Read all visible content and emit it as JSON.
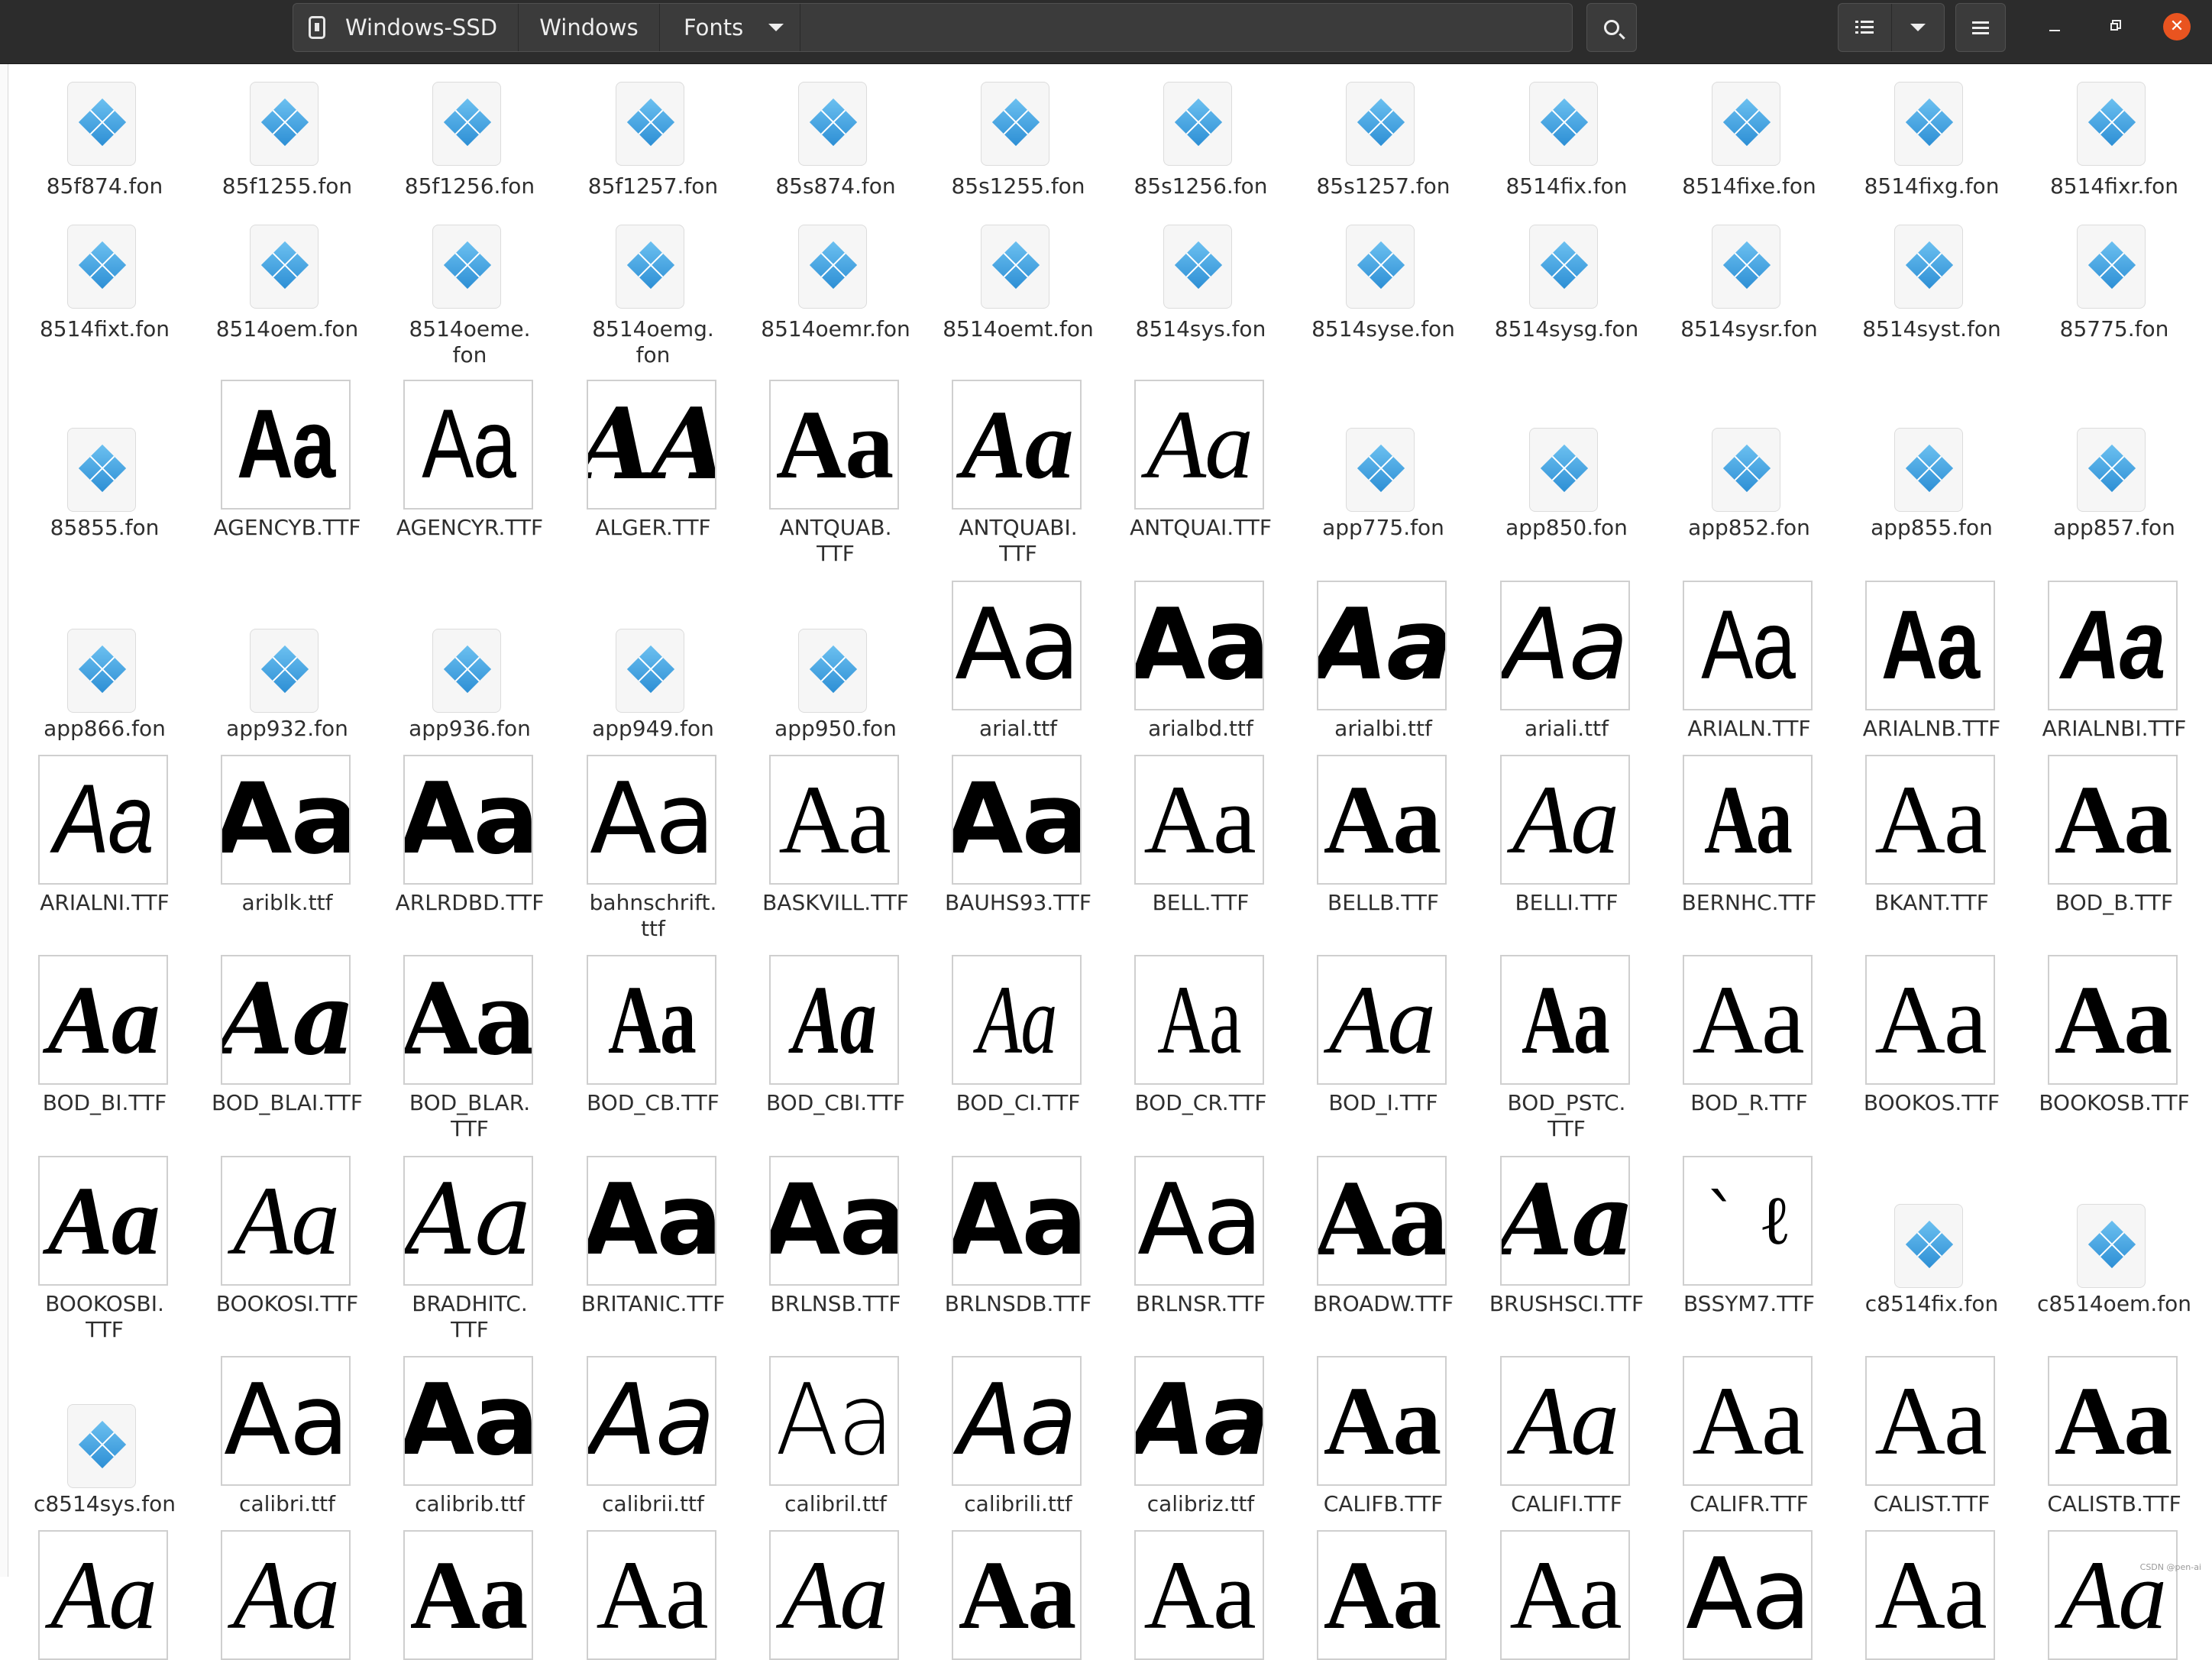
{
  "header": {
    "breadcrumb": [
      "Windows-SSD",
      "Windows",
      "Fonts"
    ],
    "icons": {
      "drive": "drive-icon",
      "search": "search-icon",
      "list_view": "list-view-icon",
      "view_options": "chevron-down-icon",
      "menu": "hamburger-menu-icon",
      "minimize": "minimize-icon",
      "maximize": "maximize-icon",
      "close": "close-icon"
    },
    "close_color": "#e95420"
  },
  "files": [
    {
      "name": "85f874.fon",
      "kind": "fon"
    },
    {
      "name": "85f1255.fon",
      "kind": "fon"
    },
    {
      "name": "85f1256.fon",
      "kind": "fon"
    },
    {
      "name": "85f1257.fon",
      "kind": "fon"
    },
    {
      "name": "85s874.fon",
      "kind": "fon"
    },
    {
      "name": "85s1255.fon",
      "kind": "fon"
    },
    {
      "name": "85s1256.fon",
      "kind": "fon"
    },
    {
      "name": "85s1257.fon",
      "kind": "fon"
    },
    {
      "name": "8514fix.fon",
      "kind": "fon"
    },
    {
      "name": "8514fixe.fon",
      "kind": "fon"
    },
    {
      "name": "8514fixg.fon",
      "kind": "fon"
    },
    {
      "name": "8514fixr.fon",
      "kind": "fon"
    },
    {
      "name": "8514fixt.fon",
      "kind": "fon"
    },
    {
      "name": "8514oem.fon",
      "kind": "fon"
    },
    {
      "name": "8514oeme.\nfon",
      "kind": "fon"
    },
    {
      "name": "8514oemg.\nfon",
      "kind": "fon"
    },
    {
      "name": "8514oemr.fon",
      "kind": "fon"
    },
    {
      "name": "8514oemt.fon",
      "kind": "fon"
    },
    {
      "name": "8514sys.fon",
      "kind": "fon"
    },
    {
      "name": "8514syse.fon",
      "kind": "fon"
    },
    {
      "name": "8514sysg.fon",
      "kind": "fon"
    },
    {
      "name": "8514sysr.fon",
      "kind": "fon"
    },
    {
      "name": "8514syst.fon",
      "kind": "fon"
    },
    {
      "name": "85775.fon",
      "kind": "fon"
    },
    {
      "name": "85855.fon",
      "kind": "fon"
    },
    {
      "name": "AGENCYB.TTF",
      "kind": "font",
      "sample": "Aa",
      "style": "sans-bold-cond"
    },
    {
      "name": "AGENCYR.TTF",
      "kind": "font",
      "sample": "Aa",
      "style": "sans-cond"
    },
    {
      "name": "ALGER.TTF",
      "kind": "font",
      "sample": "AA",
      "style": "decor"
    },
    {
      "name": "ANTQUAB.\nTTF",
      "kind": "font",
      "sample": "Aa",
      "style": "serif-bold"
    },
    {
      "name": "ANTQUABI.\nTTF",
      "kind": "font",
      "sample": "Aa",
      "style": "serif-bold-italic"
    },
    {
      "name": "ANTQUAI.TTF",
      "kind": "font",
      "sample": "Aa",
      "style": "serif-italic"
    },
    {
      "name": "app775.fon",
      "kind": "fon"
    },
    {
      "name": "app850.fon",
      "kind": "fon"
    },
    {
      "name": "app852.fon",
      "kind": "fon"
    },
    {
      "name": "app855.fon",
      "kind": "fon"
    },
    {
      "name": "app857.fon",
      "kind": "fon"
    },
    {
      "name": "app866.fon",
      "kind": "fon"
    },
    {
      "name": "app932.fon",
      "kind": "fon"
    },
    {
      "name": "app936.fon",
      "kind": "fon"
    },
    {
      "name": "app949.fon",
      "kind": "fon"
    },
    {
      "name": "app950.fon",
      "kind": "fon"
    },
    {
      "name": "arial.ttf",
      "kind": "font",
      "sample": "Aa",
      "style": "sans"
    },
    {
      "name": "arialbd.ttf",
      "kind": "font",
      "sample": "Aa",
      "style": "sans-bold"
    },
    {
      "name": "arialbi.ttf",
      "kind": "font",
      "sample": "Aa",
      "style": "sans-bold-italic"
    },
    {
      "name": "ariali.ttf",
      "kind": "font",
      "sample": "Aa",
      "style": "sans-italic"
    },
    {
      "name": "ARIALN.TTF",
      "kind": "font",
      "sample": "Aa",
      "style": "sans-cond"
    },
    {
      "name": "ARIALNB.TTF",
      "kind": "font",
      "sample": "Aa",
      "style": "sans-bold-cond"
    },
    {
      "name": "ARIALNBI.TTF",
      "kind": "font",
      "sample": "Aa",
      "style": "sans-bold-italic-cond"
    },
    {
      "name": "ARIALNI.TTF",
      "kind": "font",
      "sample": "Aa",
      "style": "sans-italic-cond"
    },
    {
      "name": "ariblk.ttf",
      "kind": "font",
      "sample": "Aa",
      "style": "sans-black"
    },
    {
      "name": "ARLRDBD.TTF",
      "kind": "font",
      "sample": "Aa",
      "style": "sans-bold"
    },
    {
      "name": "bahnschrift.\nttf",
      "kind": "font",
      "sample": "Aa",
      "style": "sans"
    },
    {
      "name": "BASKVILL.TTF",
      "kind": "font",
      "sample": "Aa",
      "style": "serif"
    },
    {
      "name": "BAUHS93.TTF",
      "kind": "font",
      "sample": "Aa",
      "style": "sans-black"
    },
    {
      "name": "BELL.TTF",
      "kind": "font",
      "sample": "Aa",
      "style": "serif"
    },
    {
      "name": "BELLB.TTF",
      "kind": "font",
      "sample": "Aa",
      "style": "serif-bold"
    },
    {
      "name": "BELLI.TTF",
      "kind": "font",
      "sample": "Aa",
      "style": "serif-italic"
    },
    {
      "name": "BERNHC.TTF",
      "kind": "font",
      "sample": "Aa",
      "style": "serif-bold-cond"
    },
    {
      "name": "BKANT.TTF",
      "kind": "font",
      "sample": "Aa",
      "style": "serif"
    },
    {
      "name": "BOD_B.TTF",
      "kind": "font",
      "sample": "Aa",
      "style": "serif-bold"
    },
    {
      "name": "BOD_BI.TTF",
      "kind": "font",
      "sample": "Aa",
      "style": "serif-bold-italic"
    },
    {
      "name": "BOD_BLAI.TTF",
      "kind": "font",
      "sample": "Aa",
      "style": "serif-black-italic"
    },
    {
      "name": "BOD_BLAR.\nTTF",
      "kind": "font",
      "sample": "Aa",
      "style": "serif-black"
    },
    {
      "name": "BOD_CB.TTF",
      "kind": "font",
      "sample": "Aa",
      "style": "serif-bold-cond"
    },
    {
      "name": "BOD_CBI.TTF",
      "kind": "font",
      "sample": "Aa",
      "style": "serif-bold-italic-cond"
    },
    {
      "name": "BOD_CI.TTF",
      "kind": "font",
      "sample": "Aa",
      "style": "serif-italic-cond"
    },
    {
      "name": "BOD_CR.TTF",
      "kind": "font",
      "sample": "Aa",
      "style": "serif-cond"
    },
    {
      "name": "BOD_I.TTF",
      "kind": "font",
      "sample": "Aa",
      "style": "serif-italic"
    },
    {
      "name": "BOD_PSTC.\nTTF",
      "kind": "font",
      "sample": "Aa",
      "style": "serif-bold-cond"
    },
    {
      "name": "BOD_R.TTF",
      "kind": "font",
      "sample": "Aa",
      "style": "serif"
    },
    {
      "name": "BOOKOS.TTF",
      "kind": "font",
      "sample": "Aa",
      "style": "serif"
    },
    {
      "name": "BOOKOSB.TTF",
      "kind": "font",
      "sample": "Aa",
      "style": "serif-bold"
    },
    {
      "name": "BOOKOSBI.\nTTF",
      "kind": "font",
      "sample": "Aa",
      "style": "serif-bold-italic"
    },
    {
      "name": "BOOKOSI.TTF",
      "kind": "font",
      "sample": "Aa",
      "style": "serif-italic"
    },
    {
      "name": "BRADHITC.\nTTF",
      "kind": "font",
      "sample": "Aa",
      "style": "script"
    },
    {
      "name": "BRITANIC.TTF",
      "kind": "font",
      "sample": "Aa",
      "style": "sans-bold"
    },
    {
      "name": "BRLNSB.TTF",
      "kind": "font",
      "sample": "Aa",
      "style": "sans-black"
    },
    {
      "name": "BRLNSDB.TTF",
      "kind": "font",
      "sample": "Aa",
      "style": "sans-bold"
    },
    {
      "name": "BRLNSR.TTF",
      "kind": "font",
      "sample": "Aa",
      "style": "sans"
    },
    {
      "name": "BROADW.TTF",
      "kind": "font",
      "sample": "Aa",
      "style": "serif-black"
    },
    {
      "name": "BRUSHSCI.TTF",
      "kind": "font",
      "sample": "Aa",
      "style": "script-bold"
    },
    {
      "name": "BSSYM7.TTF",
      "kind": "font",
      "sample": "` ℓ",
      "style": "symbol"
    },
    {
      "name": "c8514fix.fon",
      "kind": "fon"
    },
    {
      "name": "c8514oem.fon",
      "kind": "fon"
    },
    {
      "name": "c8514sys.fon",
      "kind": "fon"
    },
    {
      "name": "calibri.ttf",
      "kind": "font",
      "sample": "Aa",
      "style": "sans"
    },
    {
      "name": "calibrib.ttf",
      "kind": "font",
      "sample": "Aa",
      "style": "sans-bold"
    },
    {
      "name": "calibrii.ttf",
      "kind": "font",
      "sample": "Aa",
      "style": "sans-italic"
    },
    {
      "name": "calibril.ttf",
      "kind": "font",
      "sample": "Aa",
      "style": "sans-light"
    },
    {
      "name": "calibrili.ttf",
      "kind": "font",
      "sample": "Aa",
      "style": "sans-light-italic"
    },
    {
      "name": "calibriz.ttf",
      "kind": "font",
      "sample": "Aa",
      "style": "sans-bold-italic"
    },
    {
      "name": "CALIFB.TTF",
      "kind": "font",
      "sample": "Aa",
      "style": "serif-bold"
    },
    {
      "name": "CALIFI.TTF",
      "kind": "font",
      "sample": "Aa",
      "style": "serif-italic"
    },
    {
      "name": "CALIFR.TTF",
      "kind": "font",
      "sample": "Aa",
      "style": "serif"
    },
    {
      "name": "CALIST.TTF",
      "kind": "font",
      "sample": "Aa",
      "style": "serif"
    },
    {
      "name": "CALISTB.TTF",
      "kind": "font",
      "sample": "Aa",
      "style": "serif-bold"
    },
    {
      "name": "",
      "kind": "font",
      "sample": "Aa",
      "style": "serif-italic"
    },
    {
      "name": "",
      "kind": "font",
      "sample": "Aa",
      "style": "serif-italic"
    },
    {
      "name": "",
      "kind": "font",
      "sample": "Aa",
      "style": "serif-bold"
    },
    {
      "name": "",
      "kind": "font",
      "sample": "Aa",
      "style": "serif"
    },
    {
      "name": "",
      "kind": "font",
      "sample": "Aa",
      "style": "serif-italic"
    },
    {
      "name": "",
      "kind": "font",
      "sample": "Aa",
      "style": "serif-bold"
    },
    {
      "name": "",
      "kind": "font",
      "sample": "Aa",
      "style": "serif"
    },
    {
      "name": "",
      "kind": "font",
      "sample": "Aa",
      "style": "serif-bold"
    },
    {
      "name": "",
      "kind": "font",
      "sample": "Aa",
      "style": "serif"
    },
    {
      "name": "",
      "kind": "font",
      "sample": "Aa",
      "style": "sans"
    },
    {
      "name": "",
      "kind": "font",
      "sample": "Aa",
      "style": "serif"
    },
    {
      "name": "",
      "kind": "font",
      "sample": "Aa",
      "style": "serif-italic"
    }
  ],
  "watermark": "CSDN @pen-ai"
}
